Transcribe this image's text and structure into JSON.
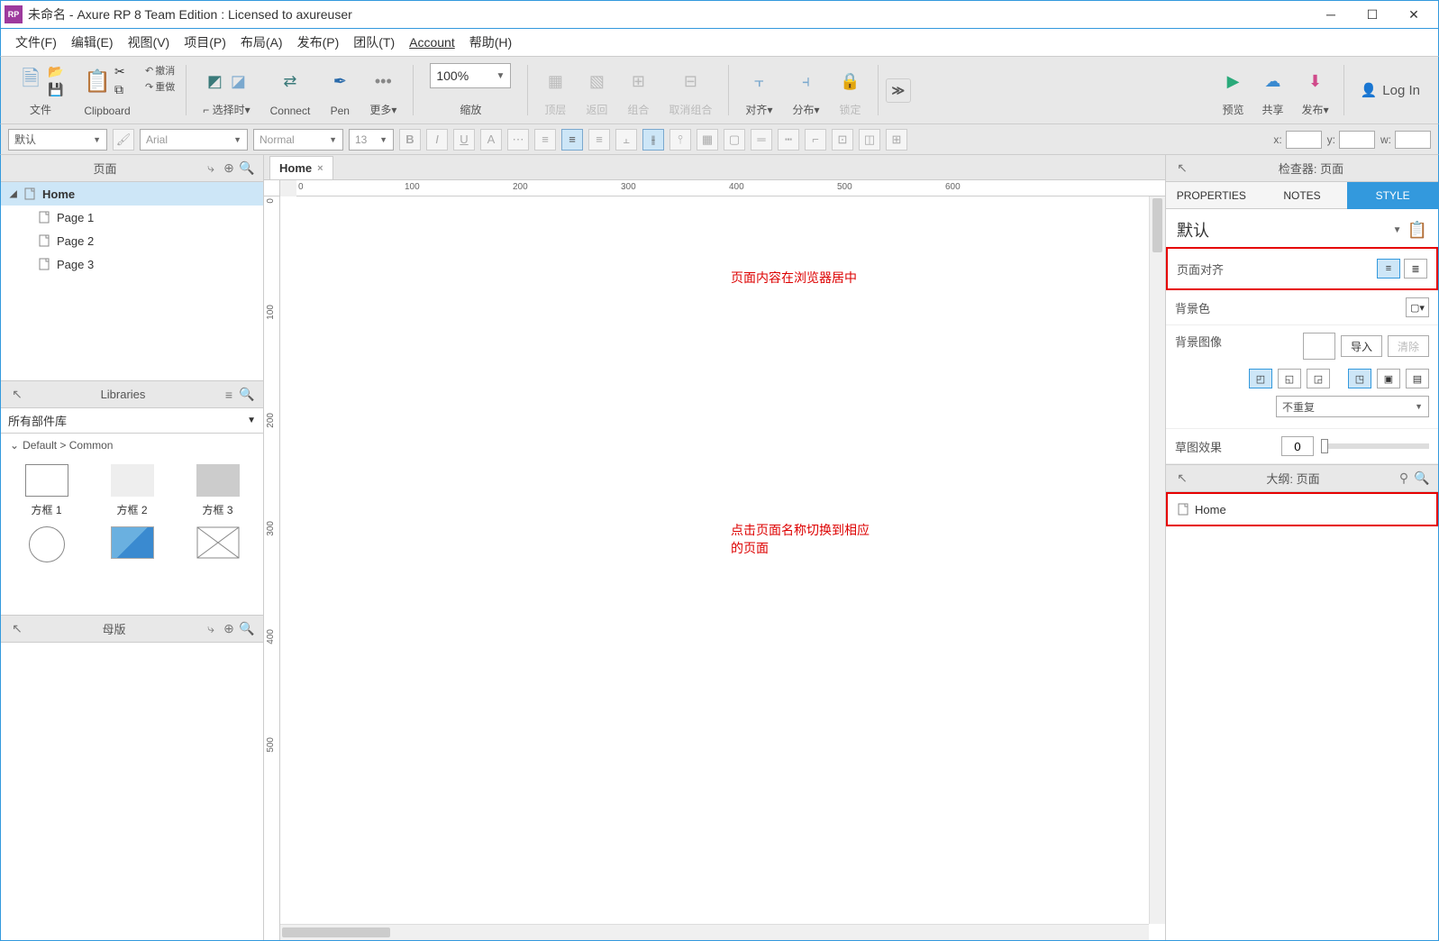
{
  "titlebar": {
    "app_icon_text": "RP",
    "title": "未命名 - Axure RP 8 Team Edition : Licensed to axureuser"
  },
  "menu": {
    "file": "文件(F)",
    "edit": "编辑(E)",
    "view": "视图(V)",
    "project": "项目(P)",
    "arrange": "布局(A)",
    "publish": "发布(P)",
    "team": "团队(T)",
    "account": "Account",
    "help": "帮助(H)"
  },
  "toolbar": {
    "file": "文件",
    "clipboard": "Clipboard",
    "undo": "撤消",
    "redo": "重做",
    "select_mode": "选择时",
    "connect": "Connect",
    "pen": "Pen",
    "more": "更多",
    "zoom_label": "缩放",
    "zoom_value": "100%",
    "front": "顶层",
    "back": "返回",
    "group": "组合",
    "ungroup": "取消组合",
    "align": "对齐",
    "distribute": "分布",
    "lock": "锁定",
    "preview": "预览",
    "share": "共享",
    "publish": "发布",
    "login": "Log In"
  },
  "formatbar": {
    "preset": "默认",
    "font": "Arial",
    "weight": "Normal",
    "size": "13",
    "coord_x": "x:",
    "coord_y": "y:",
    "coord_w": "w:"
  },
  "pages_panel": {
    "title": "页面",
    "items": [
      "Home",
      "Page 1",
      "Page 2",
      "Page 3"
    ]
  },
  "libraries_panel": {
    "title": "Libraries",
    "selector": "所有部件库",
    "category": "Default > Common",
    "widgets": [
      "方框 1",
      "方框 2",
      "方框 3"
    ]
  },
  "masters_panel": {
    "title": "母版"
  },
  "canvas": {
    "tab": "Home",
    "ruler_marks_h": [
      "0",
      "100",
      "200",
      "300",
      "400",
      "500",
      "600"
    ],
    "ruler_marks_v": [
      "0",
      "100",
      "200",
      "300",
      "400",
      "500"
    ],
    "annotation1": "页面内容在浏览器居中",
    "annotation2": "点击页面名称切换到相应的页面"
  },
  "inspector": {
    "header": "检查器: 页面",
    "tabs": {
      "properties": "PROPERTIES",
      "notes": "NOTES",
      "style": "STYLE"
    },
    "style_preset": "默认",
    "page_align": "页面对齐",
    "bg_color": "背景色",
    "bg_image": "背景图像",
    "import_btn": "导入",
    "clear_btn": "清除",
    "repeat": "不重复",
    "sketch": "草图效果",
    "sketch_value": "0"
  },
  "outline": {
    "header": "大纲: 页面",
    "item": "Home"
  }
}
